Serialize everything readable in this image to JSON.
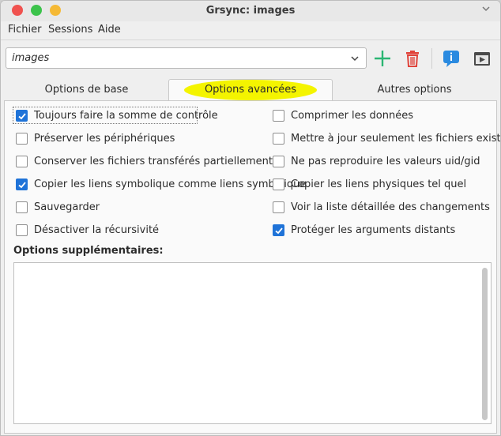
{
  "window": {
    "title": "Grsync: images"
  },
  "menubar": {
    "items": [
      "Fichier",
      "Sessions",
      "Aide"
    ]
  },
  "toolbar": {
    "session": "images",
    "icons": [
      "add-session-icon",
      "delete-session-icon",
      "info-icon",
      "run-icon"
    ]
  },
  "tabs": [
    {
      "label": "Options de base",
      "active": false
    },
    {
      "label": "Options avancées",
      "active": true
    },
    {
      "label": "Autres options",
      "active": false
    }
  ],
  "options_left": [
    {
      "label": "Toujours faire la somme de contrôle",
      "checked": true
    },
    {
      "label": "Préserver les périphériques",
      "checked": false
    },
    {
      "label": "Conserver les fichiers transférés partiellement",
      "checked": false
    },
    {
      "label": "Copier les liens symbolique comme liens symbolique",
      "checked": true
    },
    {
      "label": "Sauvegarder",
      "checked": false
    },
    {
      "label": "Désactiver la récursivité",
      "checked": false
    }
  ],
  "options_right": [
    {
      "label": "Comprimer les données",
      "checked": false
    },
    {
      "label": "Mettre à jour seulement les fichiers existants",
      "checked": false
    },
    {
      "label": "Ne pas reproduire les valeurs uid/gid",
      "checked": false
    },
    {
      "label": "Copier les liens physiques tel quel",
      "checked": false
    },
    {
      "label": "Voir la liste détaillée des changements",
      "checked": false
    },
    {
      "label": "Protéger les arguments distants",
      "checked": true
    }
  ],
  "extra_options": {
    "label": "Options supplémentaires:",
    "value": ""
  },
  "colors": {
    "accent": "#1f73d8",
    "highlight": "#f4f400",
    "add": "#2bb673",
    "delete": "#e0433a",
    "info": "#2a8ae0"
  }
}
